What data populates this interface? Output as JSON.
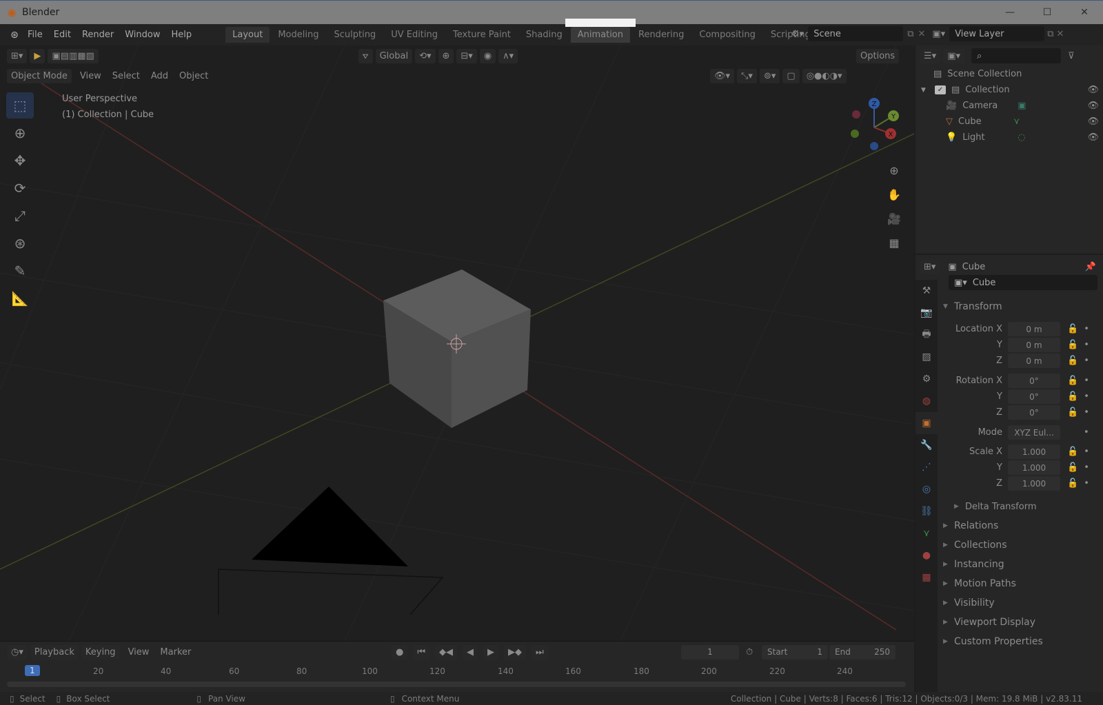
{
  "window": {
    "title": "Blender",
    "minimize": "—",
    "maximize": "☐",
    "close": "✕"
  },
  "menu": [
    "File",
    "Edit",
    "Render",
    "Window",
    "Help"
  ],
  "workspaces": [
    "Layout",
    "Modeling",
    "Sculpting",
    "UV Editing",
    "Texture Paint",
    "Shading",
    "Animation",
    "Rendering",
    "Compositing",
    "Scripting"
  ],
  "active_workspace": "Layout",
  "hover_workspace": "Animation",
  "scene": "Scene",
  "view_layer": "View Layer",
  "viewport": {
    "transform_orientation": "Global",
    "options": "Options",
    "mode": "Object Mode",
    "menus": [
      "View",
      "Select",
      "Add",
      "Object"
    ],
    "perspective": "User Perspective",
    "context": "(1) Collection | Cube",
    "gizmo": {
      "x": "X",
      "y": "Y",
      "z": "Z"
    }
  },
  "timeline": {
    "menus": [
      "Playback",
      "Keying",
      "View",
      "Marker"
    ],
    "current_frame": "1",
    "start_label": "Start",
    "start": "1",
    "end_label": "End",
    "end": "250",
    "ruler": [
      "1",
      "20",
      "40",
      "60",
      "80",
      "100",
      "120",
      "140",
      "160",
      "180",
      "200",
      "220",
      "240"
    ]
  },
  "outliner": {
    "root": "Scene Collection",
    "collection": "Collection",
    "items": [
      "Camera",
      "Cube",
      "Light"
    ]
  },
  "properties": {
    "object_name": "Cube",
    "object_field": "Cube",
    "transform": "Transform",
    "location_label": "Location X",
    "rotation_label": "Rotation X",
    "scale_label": "Scale X",
    "mode_label": "Mode",
    "y": "Y",
    "z": "Z",
    "loc": [
      "0 m",
      "0 m",
      "0 m"
    ],
    "rot": [
      "0°",
      "0°",
      "0°"
    ],
    "mode": "XYZ Eul...",
    "scale": [
      "1.000",
      "1.000",
      "1.000"
    ],
    "delta": "Delta Transform",
    "sections": [
      "Relations",
      "Collections",
      "Instancing",
      "Motion Paths",
      "Visibility",
      "Viewport Display",
      "Custom Properties"
    ]
  },
  "status": {
    "select": "Select",
    "box_select": "Box Select",
    "pan_view": "Pan View",
    "context_menu": "Context Menu",
    "stats": "Collection | Cube | Verts:8 | Faces:6 | Tris:12 | Objects:0/3 | Mem: 19.8 MiB | v2.83.11"
  }
}
